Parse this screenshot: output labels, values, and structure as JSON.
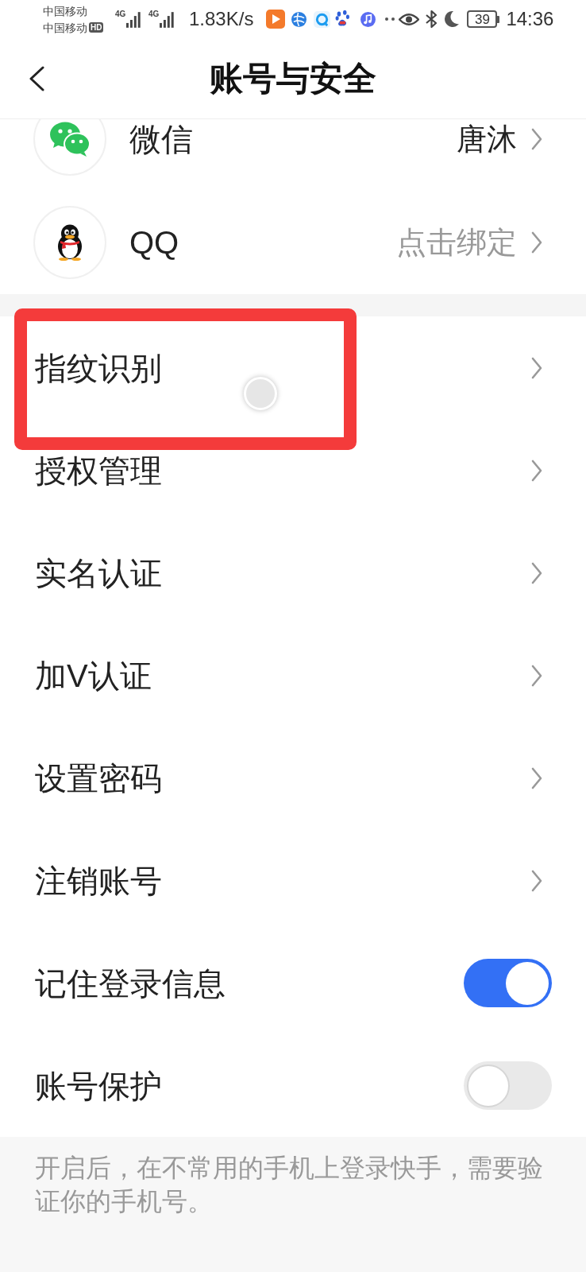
{
  "status_bar": {
    "carriers": [
      {
        "name": "中国移动"
      },
      {
        "name": "中国移动",
        "badge": "HD"
      }
    ],
    "signals": [
      {
        "network": "4G"
      },
      {
        "network": "4G"
      }
    ],
    "speed": "1.83K/s",
    "battery": "39",
    "time": "14:36"
  },
  "header": {
    "title": "账号与安全"
  },
  "linked_accounts": [
    {
      "kind": "wechat",
      "name": "微信",
      "value": "唐沐",
      "bound": true
    },
    {
      "kind": "qq",
      "name": "QQ",
      "value": "点击绑定",
      "bound": false
    }
  ],
  "settings": [
    {
      "kind": "link",
      "label": "指纹识别",
      "highlighted": true,
      "touched": true
    },
    {
      "kind": "link",
      "label": "授权管理",
      "highlighted": false,
      "touched": false
    },
    {
      "kind": "link",
      "label": "实名认证",
      "highlighted": false,
      "touched": false
    },
    {
      "kind": "link",
      "label": "加V认证",
      "highlighted": false,
      "touched": false
    },
    {
      "kind": "link",
      "label": "设置密码",
      "highlighted": false,
      "touched": false
    },
    {
      "kind": "link",
      "label": "注销账号",
      "highlighted": false,
      "touched": false
    },
    {
      "kind": "toggle",
      "label": "记住登录信息",
      "on": true,
      "highlighted": false,
      "touched": false
    },
    {
      "kind": "toggle",
      "label": "账号保护",
      "on": false,
      "highlighted": false,
      "touched": false
    }
  ],
  "footer_note": "开启后，在不常用的手机上登录快手，需要验证你的手机号。"
}
